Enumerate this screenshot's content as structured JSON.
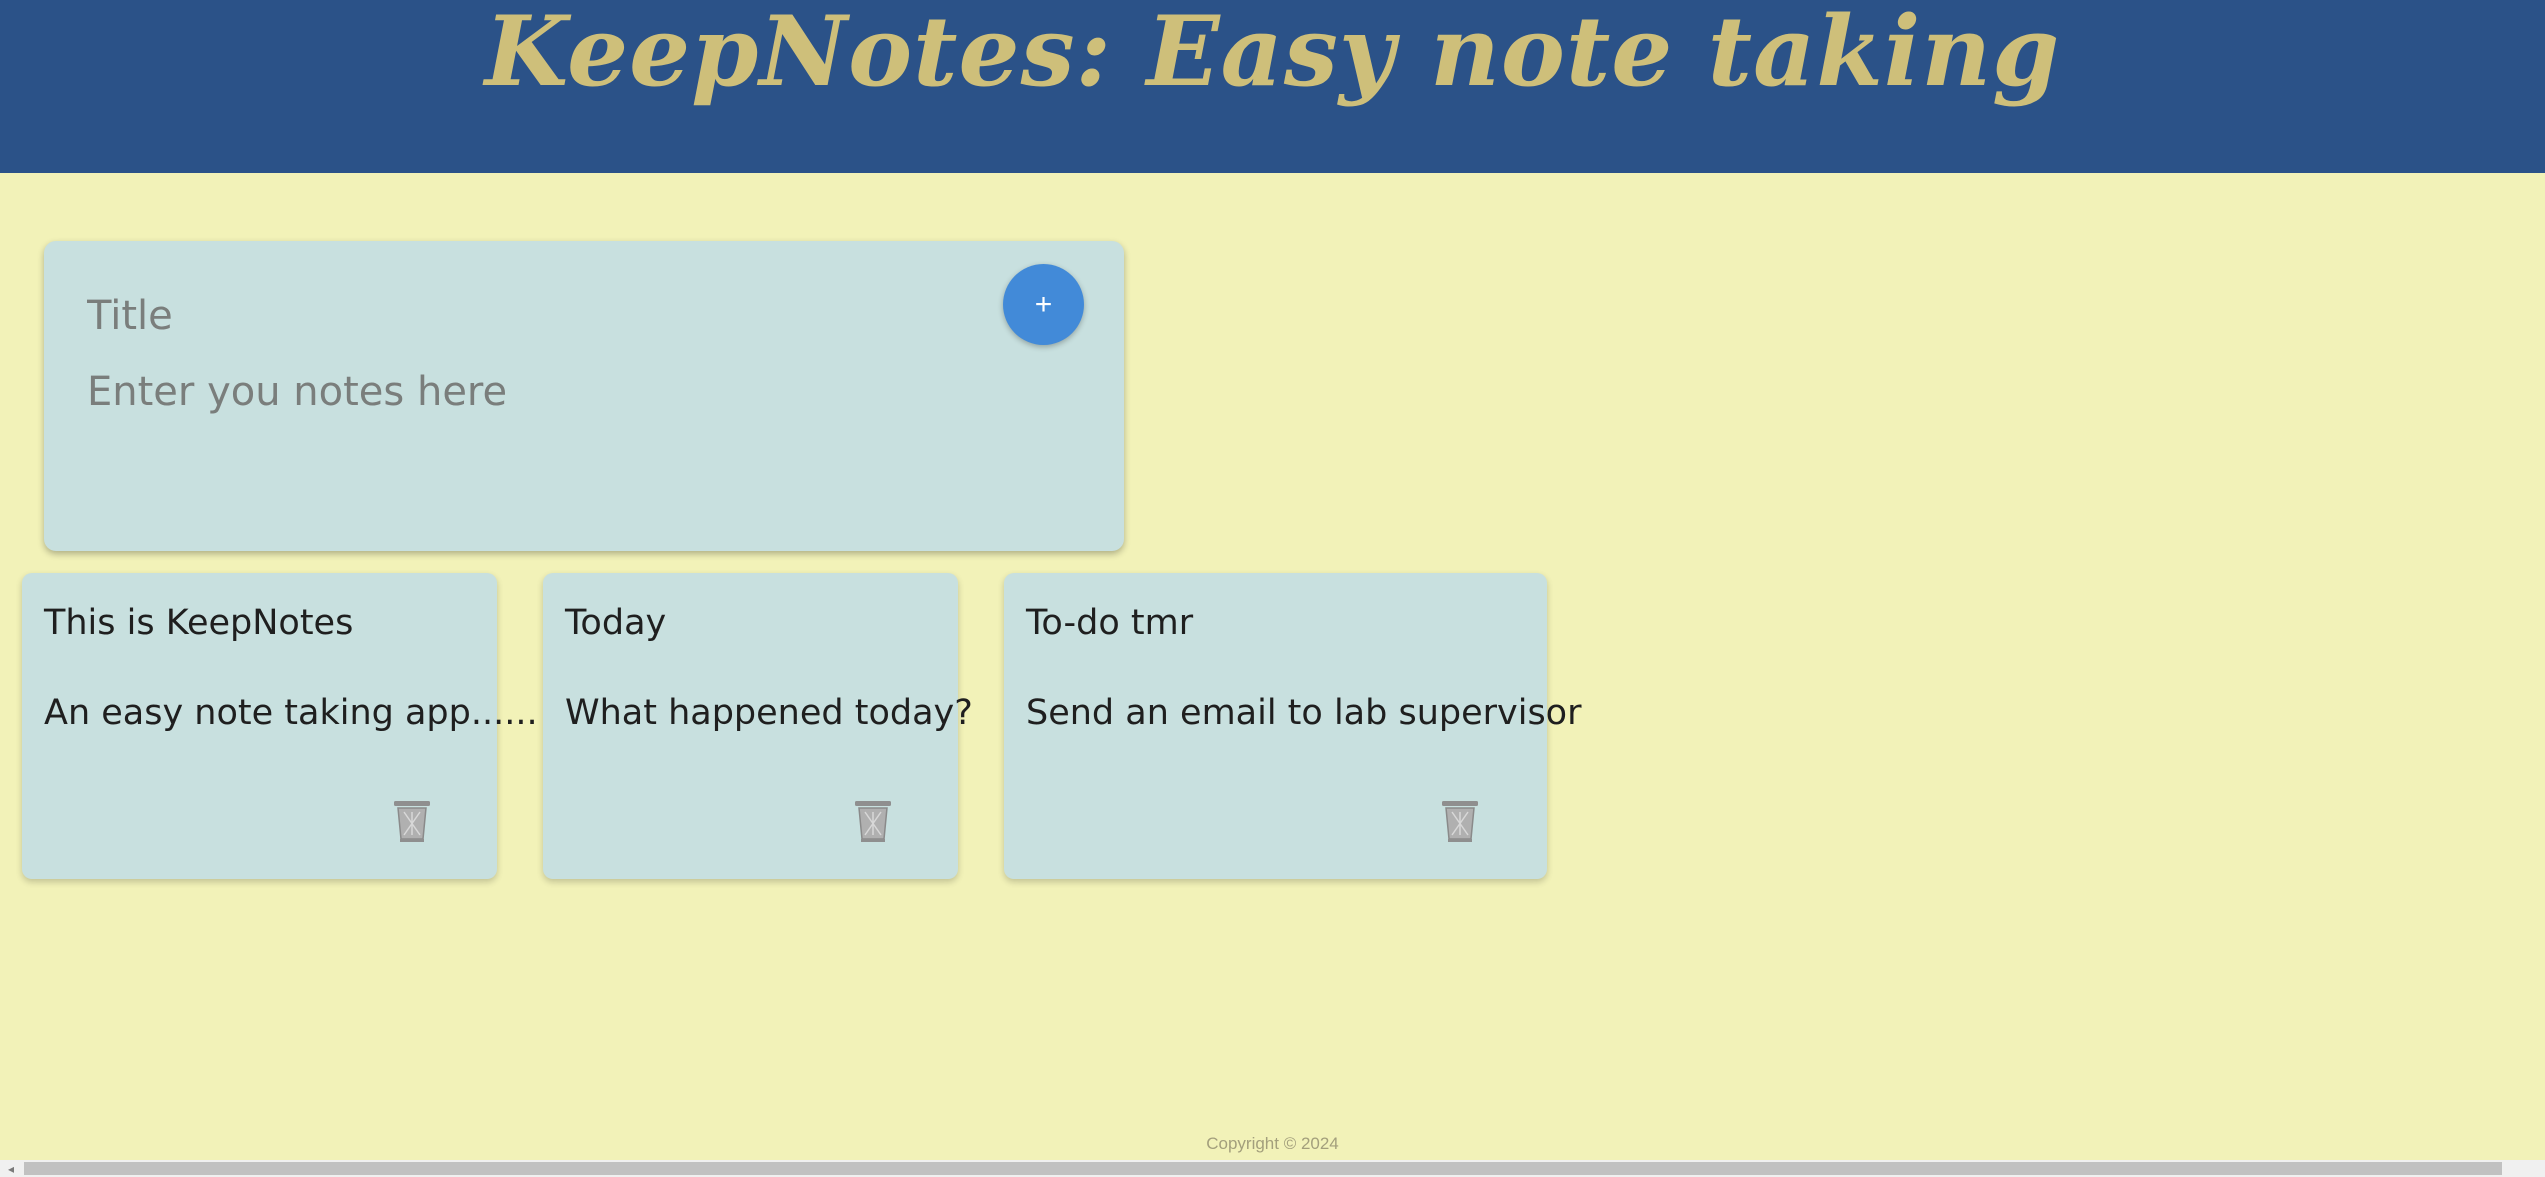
{
  "header": {
    "title": "KeepNotes: Easy note taking",
    "background": "#2b5288",
    "title_color": "#cebf7a"
  },
  "page": {
    "background": "#f2f2b8"
  },
  "composer": {
    "title_placeholder": "Title",
    "notes_placeholder": "Enter you notes here",
    "add_button_label": "+",
    "add_button_color": "#428ad8",
    "card_color": "#c8e0df"
  },
  "notes": [
    {
      "title": "This is KeepNotes",
      "body": "An easy note taking app......",
      "delete_icon": "trash-icon"
    },
    {
      "title": "Today",
      "body": "What happened today?",
      "delete_icon": "trash-icon"
    },
    {
      "title": "To-do tmr",
      "body": "Send an email to lab supervisor",
      "delete_icon": "trash-icon"
    }
  ],
  "footer": {
    "copyright": "Copyright © 2024"
  },
  "scrollbar": {
    "left_arrow": "◂"
  }
}
